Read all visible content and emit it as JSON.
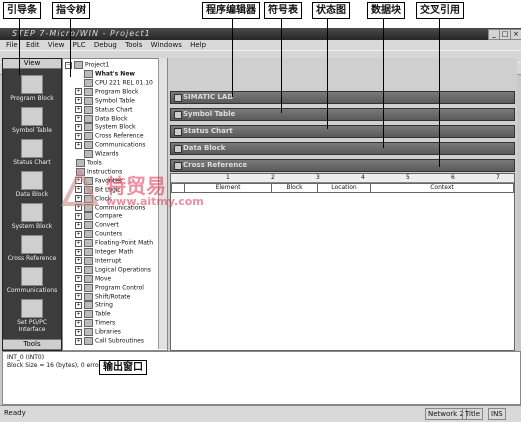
{
  "callouts": {
    "nav": "引导条",
    "tree": "指令树",
    "editor": "程序编辑器",
    "symbol": "符号表",
    "status": "状态图",
    "datablock": "数据块",
    "xref": "交叉引用"
  },
  "window": {
    "title": "STEP 7-Micro/WIN - Project1"
  },
  "menu": [
    "File",
    "Edit",
    "View",
    "PLC",
    "Debug",
    "Tools",
    "Windows",
    "Help"
  ],
  "nav": {
    "header": "View",
    "footer": "Tools",
    "items": [
      {
        "label": "Program Block",
        "icon": "program-block-icon"
      },
      {
        "label": "Symbol Table",
        "icon": "symbol-table-icon"
      },
      {
        "label": "Status Chart",
        "icon": "status-chart-icon"
      },
      {
        "label": "Data Block",
        "icon": "data-block-icon"
      },
      {
        "label": "System Block",
        "icon": "system-block-icon"
      },
      {
        "label": "Cross Reference",
        "icon": "cross-reference-icon"
      },
      {
        "label": "Communications",
        "icon": "communications-icon"
      },
      {
        "label": "Set PG/PC Interface",
        "icon": "pgpc-interface-icon"
      }
    ]
  },
  "tree": {
    "root": "Project1",
    "items": [
      "What's New",
      "CPU 221 REL 01.10",
      "Program Block",
      "Symbol Table",
      "Status Chart",
      "Data Block",
      "System Block",
      "Cross Reference",
      "Communications",
      "Wizards",
      "Tools",
      "Instructions",
      "Favorites",
      "Bit Logic",
      "Clock",
      "Communications",
      "Compare",
      "Convert",
      "Counters",
      "Floating-Point Math",
      "Integer Math",
      "Interrupt",
      "Logical Operations",
      "Move",
      "Program Control",
      "Shift/Rotate",
      "String",
      "Table",
      "Timers",
      "Libraries",
      "Call Subroutines"
    ]
  },
  "main": {
    "subwindows": [
      "SIMATIC LAD",
      "Symbol Table",
      "Status Chart",
      "Data Block",
      "Cross Reference"
    ],
    "ruler": [
      "1",
      "2",
      "3",
      "4",
      "5",
      "6",
      "7"
    ],
    "columns": [
      "Element",
      "Block",
      "Location",
      "Context"
    ]
  },
  "watermark": {
    "cn": "特贸易",
    "url": "www.aitmy.com"
  },
  "output": {
    "line1": "INT_0 (INT0)",
    "line2": "Block Size = 16 (bytes), 0 errors",
    "tag": "输出窗口"
  },
  "statusbar": {
    "ready": "Ready",
    "network": "Network 2",
    "title": "Title",
    "ins": "INS"
  }
}
